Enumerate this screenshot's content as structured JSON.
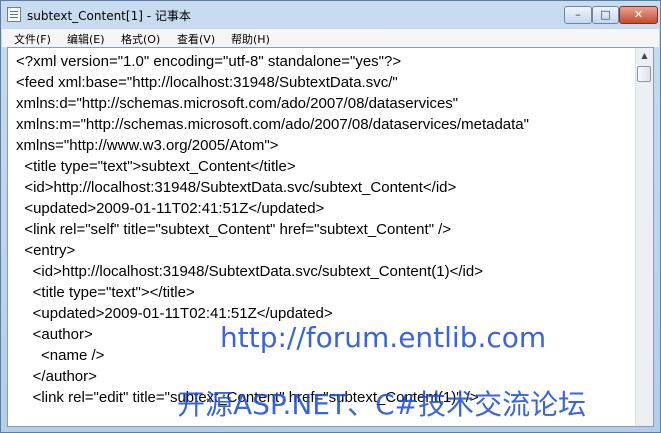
{
  "window": {
    "title": "subtext_Content[1] - 记事本",
    "controls": {
      "minimize": "–",
      "maximize": "□",
      "close": "✕"
    }
  },
  "menu": [
    {
      "label": "文件(F)"
    },
    {
      "label": "编辑(E)"
    },
    {
      "label": "格式(O)"
    },
    {
      "label": "查看(V)"
    },
    {
      "label": "帮助(H)"
    }
  ],
  "content": {
    "lines": [
      "<?xml version=\"1.0\" encoding=\"utf-8\" standalone=\"yes\"?>",
      "<feed xml:base=\"http://localhost:31948/SubtextData.svc/\"",
      "xmlns:d=\"http://schemas.microsoft.com/ado/2007/08/dataservices\"",
      "xmlns:m=\"http://schemas.microsoft.com/ado/2007/08/dataservices/metadata\"",
      "xmlns=\"http://www.w3.org/2005/Atom\">",
      "  <title type=\"text\">subtext_Content</title>",
      "  <id>http://localhost:31948/SubtextData.svc/subtext_Content</id>",
      "  <updated>2009-01-11T02:41:51Z</updated>",
      "  <link rel=\"self\" title=\"subtext_Content\" href=\"subtext_Content\" />",
      "  <entry>",
      "    <id>http://localhost:31948/SubtextData.svc/subtext_Content(1)</id>",
      "    <title type=\"text\"></title>",
      "    <updated>2009-01-11T02:41:51Z</updated>",
      "    <author>",
      "      <name />",
      "    </author>",
      "    <link rel=\"edit\" title=\"subtext_Content\" href=\"subtext_Content(1)\" />"
    ]
  },
  "watermark": {
    "url": "http://forum.entlib.com",
    "text": "开源ASP.NET、C#技术交流论坛"
  }
}
